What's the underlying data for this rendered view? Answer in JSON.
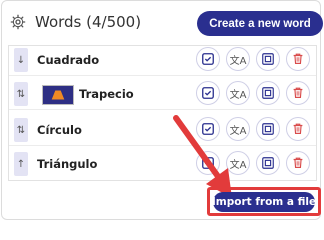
{
  "header": {
    "title": "Words (4/500)",
    "create_label": "Create a new word"
  },
  "words": [
    {
      "label": "Cuadrado",
      "handle_icon": "arrow-down",
      "has_thumb": false
    },
    {
      "label": "Trapecio",
      "handle_icon": "arrows-up-down",
      "has_thumb": true
    },
    {
      "label": "Círculo",
      "handle_icon": "arrows-up-down",
      "has_thumb": false
    },
    {
      "label": "Triángulo",
      "handle_icon": "arrow-up",
      "has_thumb": false
    }
  ],
  "import_label": "Import from a file",
  "colors": {
    "primary": "#2a2f8f",
    "highlight": "#e23b3b",
    "delete": "#d94b4b"
  },
  "icons": {
    "settings": "gear-icon",
    "validate": "checkbox-icon",
    "translate": "translate-icon",
    "duplicate": "copy-icon",
    "delete": "trash-icon",
    "annotation": "red-arrow-icon"
  }
}
